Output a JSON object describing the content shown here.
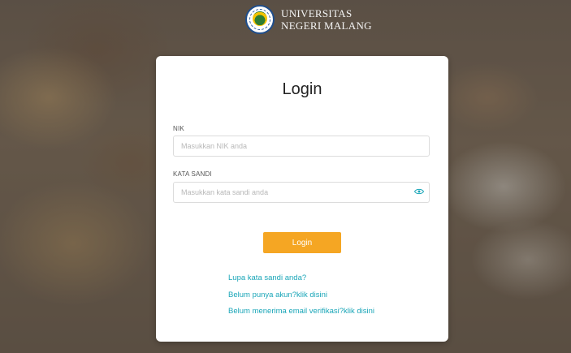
{
  "brand": {
    "line1": "UNIVERSITAS",
    "line2": "NEGERI MALANG",
    "logo_icon": "university-seal-icon"
  },
  "login": {
    "title": "Login",
    "nik_label": "NIK",
    "nik_placeholder": "Masukkan NIK anda",
    "password_label": "KATA SANDI",
    "password_placeholder": "Masukkan kata sandi anda",
    "toggle_icon": "eye-icon",
    "submit_label": "Login"
  },
  "links": {
    "forgot": "Lupa kata sandi anda?",
    "register": "Belum punya akun?klik disini",
    "verify": "Belum menerima email verifikasi?klik disini"
  },
  "colors": {
    "accent": "#f5a623",
    "link": "#1aa6b8",
    "brand_ring": "#1f4e8c"
  }
}
